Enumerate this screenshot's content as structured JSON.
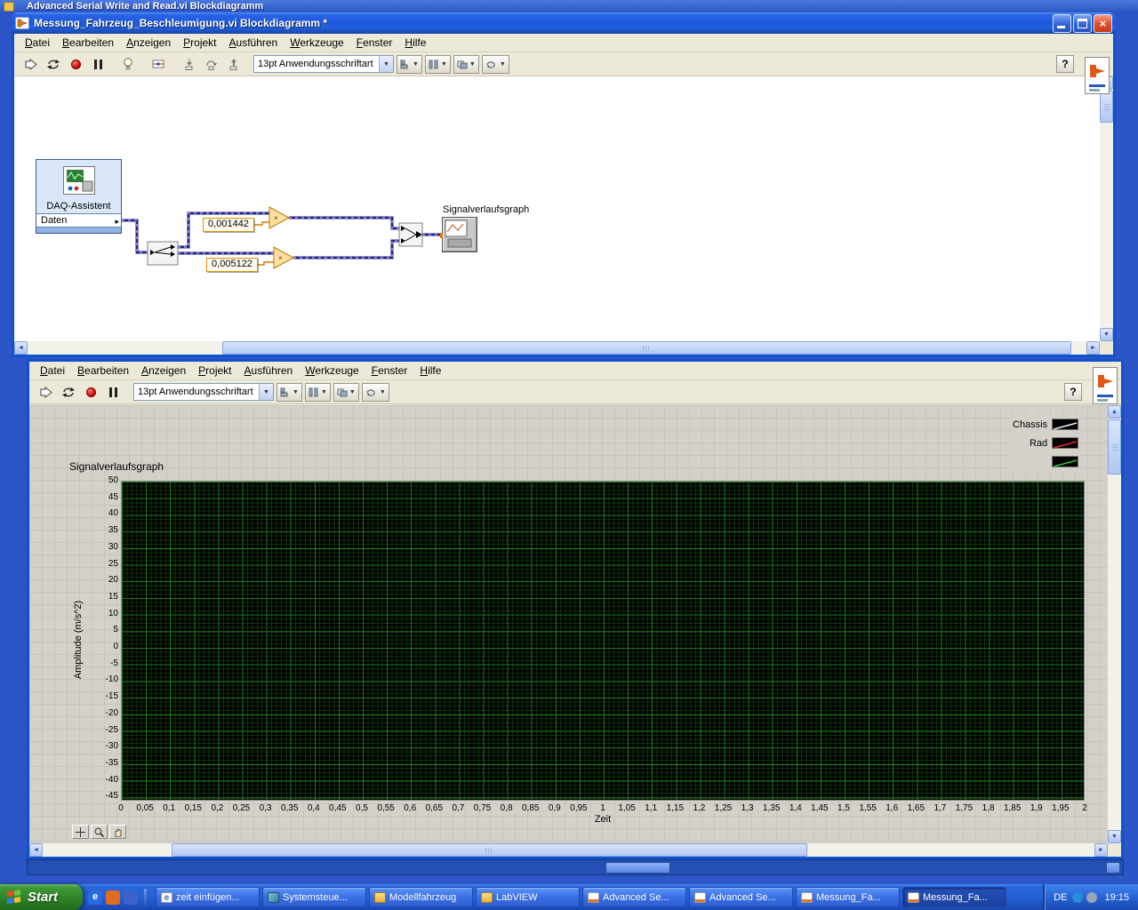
{
  "background_window": {
    "title": "Advanced Serial Write and Read.vi Blockdiagramm"
  },
  "menus": [
    "Datei",
    "Bearbeiten",
    "Anzeigen",
    "Projekt",
    "Ausführen",
    "Werkzeuge",
    "Fenster",
    "Hilfe"
  ],
  "block_window": {
    "title": "Messung_Fahrzeug_Beschleumigung.vi Blockdiagramm *",
    "font_selector": "13pt Anwendungsschriftart",
    "help_label": "?",
    "diagram": {
      "daq_label": "DAQ-Assistent",
      "daq_output": "Daten",
      "constant_1": "0,001442",
      "constant_2": "0,005122",
      "graph_terminal_label": "Signalverlaufsgraph"
    }
  },
  "panel_window": {
    "font_selector": "13pt Anwendungsschriftart",
    "help_label": "?",
    "graph": {
      "label": "Signalverlaufsgraph",
      "legend": [
        {
          "name": "Chassis",
          "color": "#f2f2f2"
        },
        {
          "name": "Rad",
          "color": "#e03030"
        },
        {
          "name": "",
          "color": "#30c030"
        }
      ],
      "y_axis": {
        "title": "Amplitude (m/s^2)",
        "ticks": [
          "50",
          "45",
          "40",
          "35",
          "30",
          "25",
          "20",
          "15",
          "10",
          "5",
          "0",
          "-5",
          "-10",
          "-15",
          "-20",
          "-25",
          "-30",
          "-35",
          "-40",
          "-45"
        ]
      },
      "x_axis": {
        "title": "Zeit",
        "ticks": [
          "0",
          "0,05",
          "0,1",
          "0,15",
          "0,2",
          "0,25",
          "0,3",
          "0,35",
          "0,4",
          "0,45",
          "0,5",
          "0,55",
          "0,6",
          "0,65",
          "0,7",
          "0,75",
          "0,8",
          "0,85",
          "0,9",
          "0,95",
          "1",
          "1,05",
          "1,1",
          "1,15",
          "1,2",
          "1,25",
          "1,3",
          "1,35",
          "1,4",
          "1,45",
          "1,5",
          "1,55",
          "1,6",
          "1,65",
          "1,7",
          "1,75",
          "1,8",
          "1,85",
          "1,9",
          "1,95",
          "2"
        ]
      }
    }
  },
  "taskbar": {
    "start_label": "Start",
    "quick_launch": [
      {
        "name": "internet-explorer",
        "color": "#2a6ae0",
        "glyph": "e"
      },
      {
        "name": "media-player",
        "color": "#e06a20",
        "glyph": ""
      },
      {
        "name": "firefox",
        "color": "#3a62c8",
        "glyph": ""
      }
    ],
    "tasks": [
      {
        "label": "zeit einfügen...",
        "icon": "ie-page",
        "active": false
      },
      {
        "label": "Systemsteue...",
        "icon": "control-panel",
        "active": false
      },
      {
        "label": "Modellfahrzeug",
        "icon": "folder",
        "active": false
      },
      {
        "label": "LabVIEW",
        "icon": "folder",
        "active": false
      },
      {
        "label": "Advanced Se...",
        "icon": "labview-vi",
        "active": false
      },
      {
        "label": "Advanced Se...",
        "icon": "labview-vi",
        "active": false
      },
      {
        "label": "Messung_Fa...",
        "icon": "labview-vi",
        "active": false
      },
      {
        "label": "Messung_Fa...",
        "icon": "labview-vi",
        "active": true
      }
    ],
    "tray": {
      "language": "DE",
      "time": "19:15",
      "icons": [
        {
          "name": "language-bar",
          "color": "#2a8ae0"
        },
        {
          "name": "safely-remove",
          "color": "#9aa4b4"
        }
      ]
    }
  }
}
